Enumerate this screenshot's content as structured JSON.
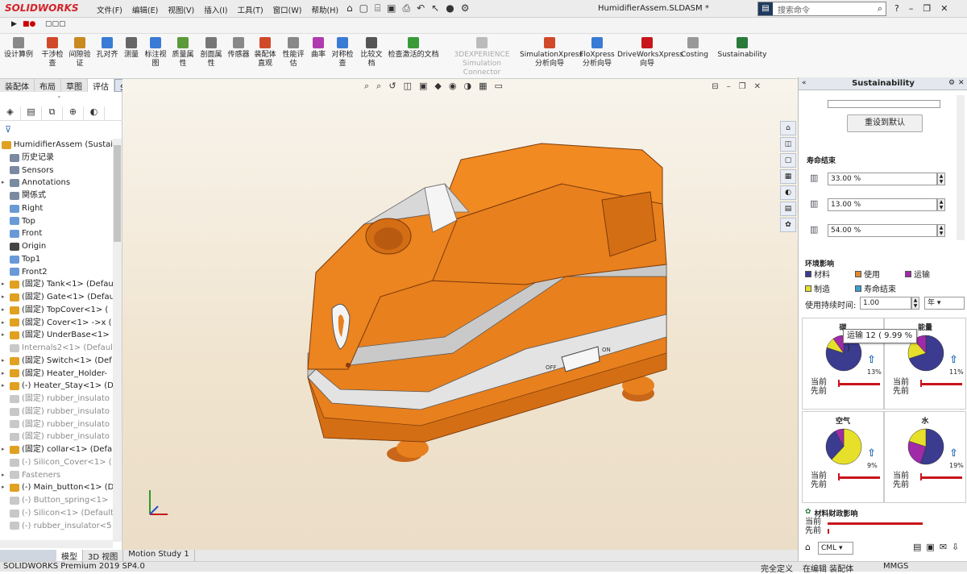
{
  "app": {
    "logo_text": "SOLIDWORKS",
    "doc_title": "HumidifierAssem.SLDASM *",
    "search_placeholder": "搜索命令",
    "menu": [
      "文件(F)",
      "编辑(E)",
      "视图(V)",
      "插入(I)",
      "工具(T)",
      "窗口(W)",
      "帮助(H)"
    ]
  },
  "commands": [
    {
      "label": "设计算例",
      "color": "#888"
    },
    {
      "label": "干涉检查",
      "color": "#d04a2a"
    },
    {
      "label": "间隙验证",
      "color": "#c98a1f"
    },
    {
      "label": "孔对齐",
      "color": "#3a7bd5"
    },
    {
      "label": "测量",
      "color": "#666"
    },
    {
      "label": "标注视图",
      "color": "#3a7bd5"
    },
    {
      "label": "质量属性",
      "color": "#5a9a3a"
    },
    {
      "label": "剖面属性",
      "color": "#777"
    },
    {
      "label": "传感器",
      "color": "#888"
    },
    {
      "label": "装配体直观",
      "color": "#d04a2a"
    },
    {
      "label": "性能评估",
      "color": "#888"
    },
    {
      "label": "曲率",
      "color": "#b03ab0"
    },
    {
      "label": "对称检查",
      "color": "#3a7bd5"
    },
    {
      "label": "比较文档",
      "color": "#555"
    },
    {
      "label": "检查激活的文档",
      "color": "#3a9a3a"
    },
    {
      "label": "3DEXPERIENCE Simulation Connector",
      "color": "#bbb"
    },
    {
      "label": "SimulationXpress 分析向导",
      "color": "#d04a2a"
    },
    {
      "label": "FloXpress 分析向导",
      "color": "#3a7bd5"
    },
    {
      "label": "DriveWorksXpress 向导",
      "color": "#c8151b"
    },
    {
      "label": "Costing",
      "color": "#999"
    },
    {
      "label": "Sustainability",
      "color": "#2a7a3a"
    }
  ],
  "tabs": [
    "装配体",
    "布局",
    "草图",
    "评估",
    "SOLIDWORKS 插件"
  ],
  "tree": {
    "root": "HumidifierAssem (Sustai",
    "items": [
      {
        "label": "历史记录",
        "icon": "history-icon",
        "color": "#7a8aa0",
        "arrow": false,
        "grey": false
      },
      {
        "label": "Sensors",
        "icon": "sensor-icon",
        "color": "#7a8aa0",
        "arrow": false,
        "grey": false
      },
      {
        "label": "Annotations",
        "icon": "annotation-icon",
        "color": "#7a8aa0",
        "arrow": true,
        "grey": false
      },
      {
        "label": "関係式",
        "icon": "equation-icon",
        "color": "#7a8aa0",
        "arrow": false,
        "grey": false
      },
      {
        "label": "Right",
        "icon": "plane-icon",
        "color": "#6a9ad6",
        "arrow": false,
        "grey": false
      },
      {
        "label": "Top",
        "icon": "plane-icon",
        "color": "#6a9ad6",
        "arrow": false,
        "grey": false
      },
      {
        "label": "Front",
        "icon": "plane-icon",
        "color": "#6a9ad6",
        "arrow": false,
        "grey": false
      },
      {
        "label": "Origin",
        "icon": "origin-icon",
        "color": "#444",
        "arrow": false,
        "grey": false
      },
      {
        "label": "Top1",
        "icon": "plane-icon",
        "color": "#6a9ad6",
        "arrow": false,
        "grey": false
      },
      {
        "label": "Front2",
        "icon": "plane-icon",
        "color": "#6a9ad6",
        "arrow": false,
        "grey": false
      },
      {
        "label": "(固定) Tank<1> (Defau",
        "icon": "part-icon",
        "color": "#e0a020",
        "arrow": true,
        "grey": false
      },
      {
        "label": "(固定) Gate<1> (Defau",
        "icon": "part-icon",
        "color": "#e0a020",
        "arrow": true,
        "grey": false
      },
      {
        "label": "(固定) TopCover<1> (",
        "icon": "part-icon",
        "color": "#e0a020",
        "arrow": true,
        "grey": false
      },
      {
        "label": "(固定) Cover<1> ->x (",
        "icon": "part-icon",
        "color": "#e0a020",
        "arrow": true,
        "grey": false
      },
      {
        "label": "(固定) UnderBase<1>",
        "icon": "part-icon",
        "color": "#e0a020",
        "arrow": true,
        "grey": false
      },
      {
        "label": "Internals2<1> (Defaul",
        "icon": "part-icon",
        "color": "#c8c8c8",
        "arrow": false,
        "grey": true
      },
      {
        "label": "(固定) Switch<1> (Def",
        "icon": "part-icon",
        "color": "#e0a020",
        "arrow": true,
        "grey": false
      },
      {
        "label": "(固定) Heater_Holder-",
        "icon": "part-icon",
        "color": "#e0a020",
        "arrow": true,
        "grey": false
      },
      {
        "label": "(-) Heater_Stay<1> (D",
        "icon": "part-icon",
        "color": "#e0a020",
        "arrow": true,
        "grey": false
      },
      {
        "label": "(固定) rubber_insulato",
        "icon": "part-icon",
        "color": "#c8c8c8",
        "arrow": false,
        "grey": true
      },
      {
        "label": "(固定) rubber_insulato",
        "icon": "part-icon",
        "color": "#c8c8c8",
        "arrow": false,
        "grey": true
      },
      {
        "label": "(固定) rubber_insulato",
        "icon": "part-icon",
        "color": "#c8c8c8",
        "arrow": false,
        "grey": true
      },
      {
        "label": "(固定) rubber_insulato",
        "icon": "part-icon",
        "color": "#c8c8c8",
        "arrow": false,
        "grey": true
      },
      {
        "label": "(固定) collar<1> (Defa",
        "icon": "part-icon",
        "color": "#e0a020",
        "arrow": true,
        "grey": false
      },
      {
        "label": "(-) Silicon_Cover<1> (",
        "icon": "part-icon",
        "color": "#c8c8c8",
        "arrow": false,
        "grey": true
      },
      {
        "label": "Fasteners",
        "icon": "folder-icon",
        "color": "#c8c8c8",
        "arrow": true,
        "grey": true
      },
      {
        "label": "(-) Main_button<1> (D",
        "icon": "part-icon",
        "color": "#e0a020",
        "arrow": true,
        "grey": false
      },
      {
        "label": "(-) Button_spring<1>",
        "icon": "part-icon",
        "color": "#c8c8c8",
        "arrow": false,
        "grey": true
      },
      {
        "label": "(-) Silicon<1> (Default",
        "icon": "part-icon",
        "color": "#c8c8c8",
        "arrow": false,
        "grey": true
      },
      {
        "label": "(-) rubber_insulator<5",
        "icon": "part-icon",
        "color": "#c8c8c8",
        "arrow": false,
        "grey": true
      }
    ]
  },
  "bottom_tabs": [
    "模型",
    "3D 视图",
    "Motion Study 1"
  ],
  "status": {
    "product": "SOLIDWORKS Premium 2019 SP4.0",
    "defined": "完全定义",
    "editing": "在编辑 装配体",
    "units": "MMGS"
  },
  "sus": {
    "title": "Sustainability",
    "reset_button": "重设到默认",
    "eol_title": "寿命结束",
    "eol_values": [
      "33.00 %",
      "13.00 %",
      "54.00 %"
    ],
    "env_title": "环境影响",
    "legend": [
      {
        "label": "材料",
        "color": "#3b3c8f"
      },
      {
        "label": "使用",
        "color": "#e08a2a"
      },
      {
        "label": "运输",
        "color": "#a02aa8"
      },
      {
        "label": "制造",
        "color": "#e6e02a"
      },
      {
        "label": "寿命结束",
        "color": "#3aa0d0"
      }
    ],
    "duration_label": "使用持续时间:",
    "duration_value": "1.00",
    "duration_unit": "年",
    "cells": [
      {
        "title": "碳",
        "pct": "13%",
        "cur": "当前",
        "prev": "先前",
        "a": 0.13
      },
      {
        "title": "能量",
        "pct": "11%",
        "cur": "当前",
        "prev": "先前",
        "a": 0.11
      },
      {
        "title": "空气",
        "pct": "9%",
        "cur": "当前",
        "prev": "先前",
        "a": 0.09
      },
      {
        "title": "水",
        "pct": "19%",
        "cur": "当前",
        "prev": "先前",
        "a": 0.19
      }
    ],
    "tooltip": "运输 12 ( 9.99 % )",
    "fin_title": "材料财政影响",
    "fin_cur": "当前",
    "fin_prev": "先前",
    "unit_select": "CML"
  }
}
